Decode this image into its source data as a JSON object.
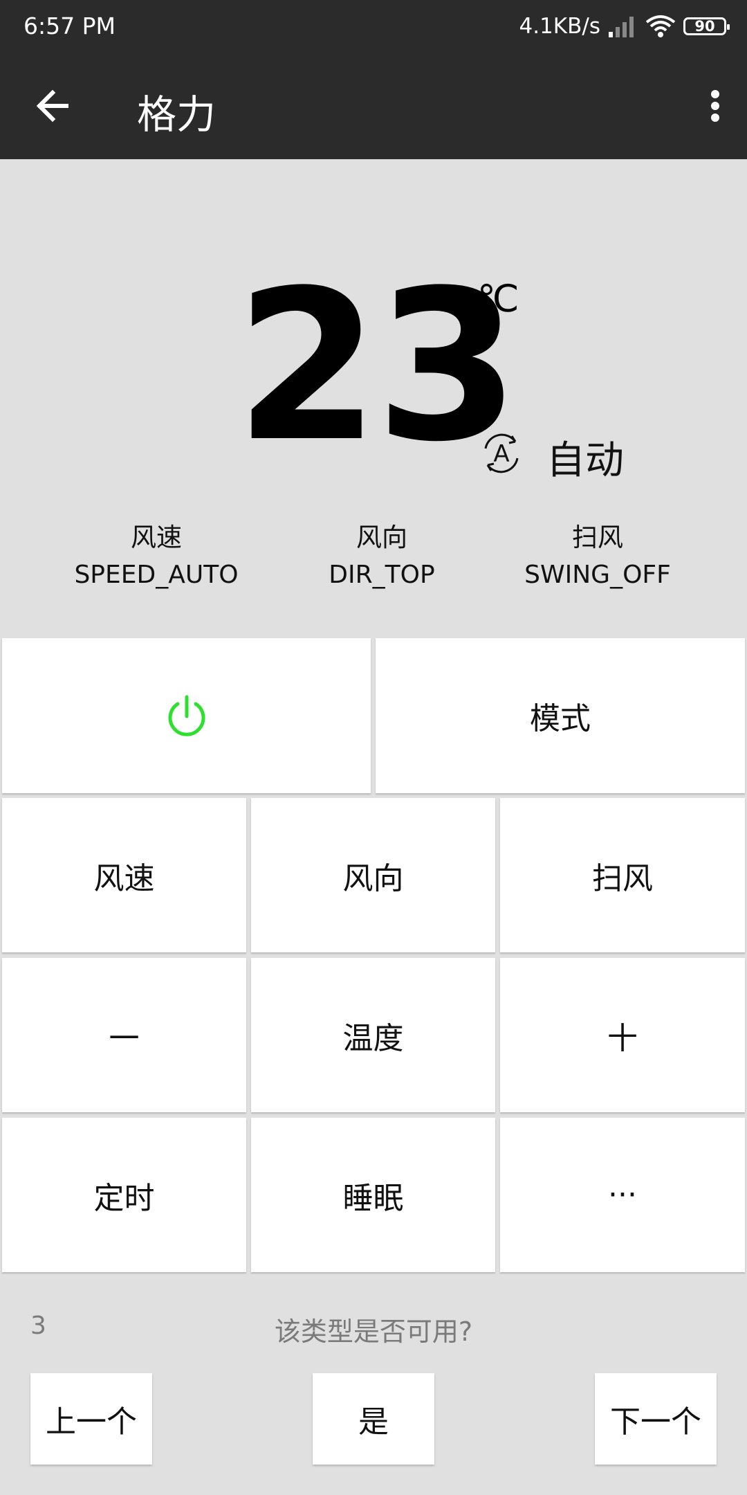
{
  "status_bar": {
    "time": "6:57 PM",
    "net_speed": "4.1KB/s",
    "battery": "90"
  },
  "app_bar": {
    "title": "格力"
  },
  "display": {
    "temperature": "23",
    "unit": "℃",
    "mode": "自动",
    "status": [
      {
        "label": "风速",
        "value": "SPEED_AUTO"
      },
      {
        "label": "风向",
        "value": "DIR_TOP"
      },
      {
        "label": "扫风",
        "value": "SWING_OFF"
      }
    ]
  },
  "keypad": {
    "power_color": "#2ee02e",
    "mode": "模式",
    "fan_speed": "风速",
    "fan_direction": "风向",
    "swing": "扫风",
    "minus": "一",
    "temperature": "温度",
    "plus": "十",
    "timer": "定时",
    "sleep": "睡眠",
    "more": "···"
  },
  "footer": {
    "count": "3",
    "question": "该类型是否可用?",
    "prev": "上一个",
    "yes": "是",
    "next": "下一个"
  }
}
